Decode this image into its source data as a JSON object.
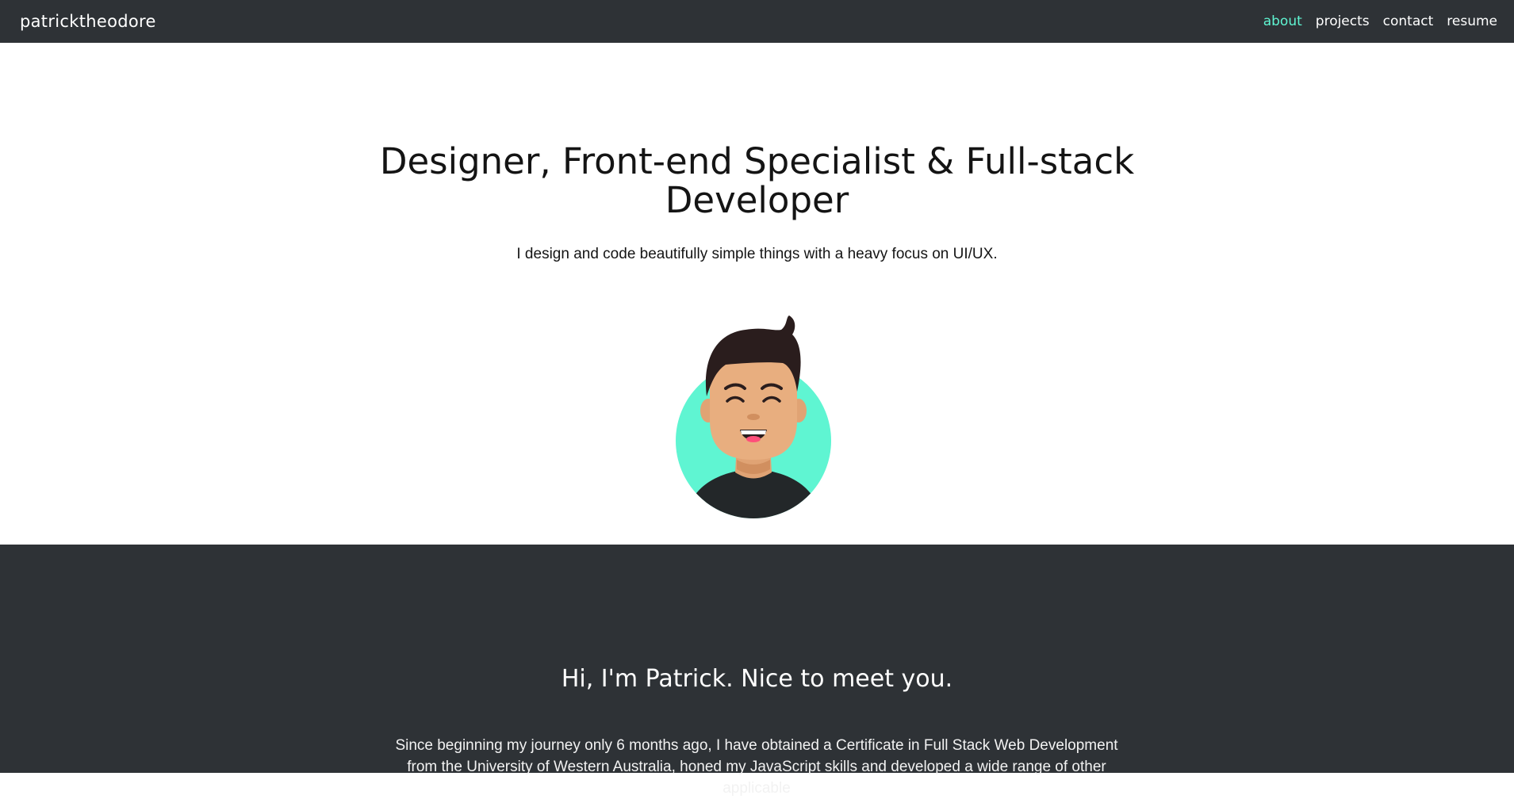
{
  "nav": {
    "brand": "patricktheodore",
    "links": [
      {
        "label": "about",
        "active": true
      },
      {
        "label": "projects",
        "active": false
      },
      {
        "label": "contact",
        "active": false
      },
      {
        "label": "resume",
        "active": false
      }
    ]
  },
  "hero": {
    "title_line1": "Designer, Front-end Specialist & Full-stack",
    "title_line2": "Developer",
    "subtitle": "I design and code beautifully simple things with a heavy focus on UI/UX."
  },
  "about": {
    "title": "Hi, I'm Patrick. Nice to meet you.",
    "text": "Since beginning my journey only 6 months ago, I have obtained a Certificate in Full Stack Web Development from the University of Western Australia, honed my JavaScript skills and developed a wide range of other applicable"
  },
  "colors": {
    "navbar_bg": "#2e3236",
    "accent": "#5ff5d2",
    "avatar_bg": "#5ff5d2",
    "skin": "#e8ae7f",
    "hair": "#2a1d1d",
    "shirt": "#232729"
  },
  "icons": {
    "avatar": "smiling-man-avatar"
  }
}
